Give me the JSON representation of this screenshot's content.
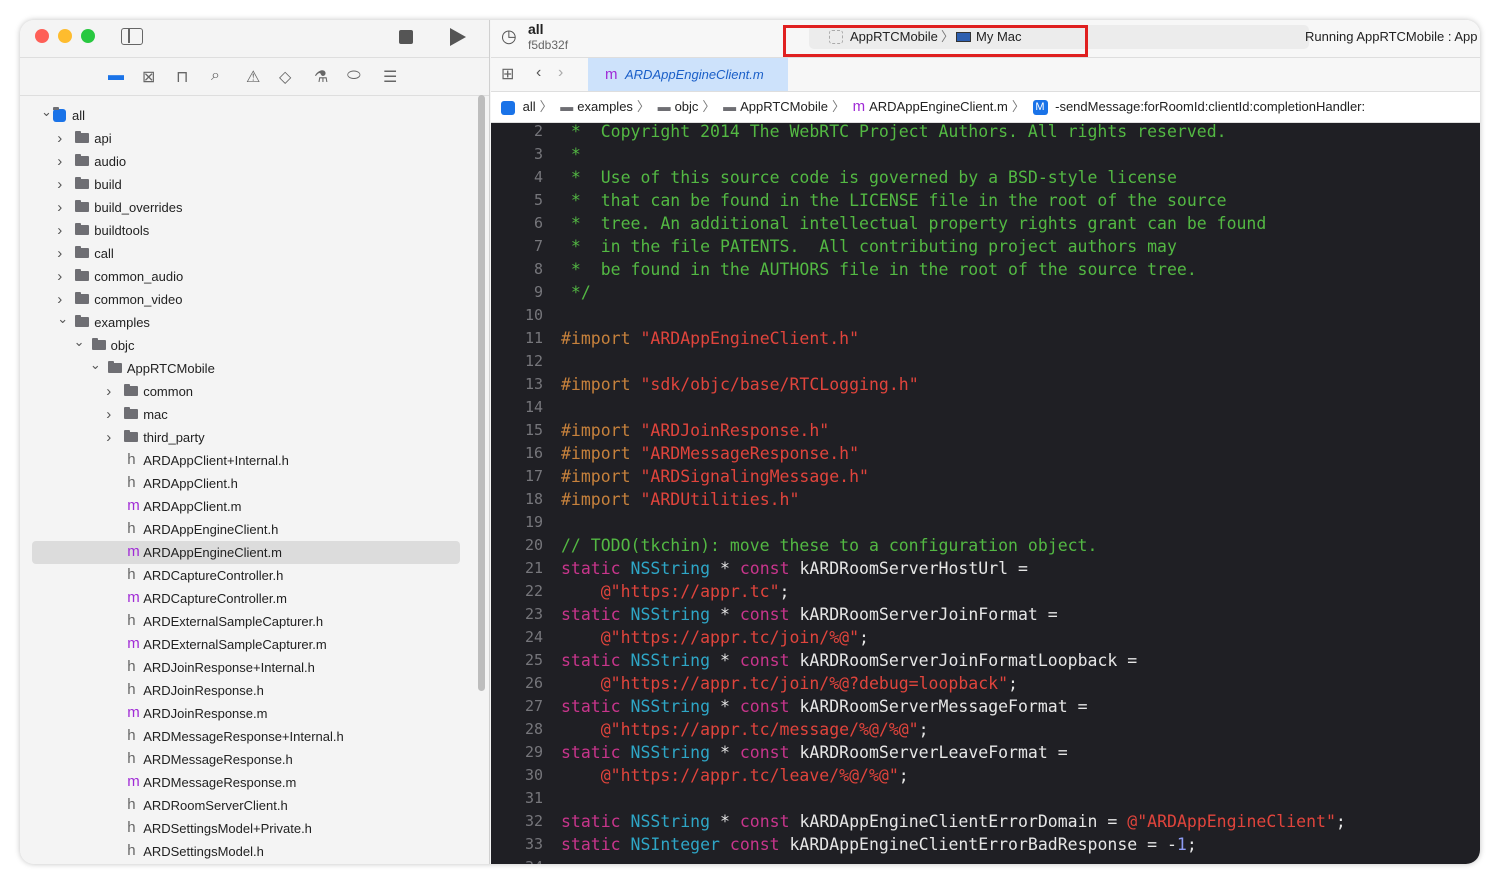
{
  "toolbar": {
    "scheme_title": "all",
    "commit": "f5db32f",
    "scheme": "AppRTCMobile",
    "destination": "My Mac",
    "status": "Running AppRTCMobile : App"
  },
  "editor_tab": {
    "label": "ARDAppEngineClient.m"
  },
  "breadcrumb": [
    "all",
    "examples",
    "objc",
    "AppRTCMobile",
    "ARDAppEngineClient.m",
    "-sendMessage:forRoomId:clientId:completionHandler:"
  ],
  "navigator_icons": [
    "folder-icon",
    "source-control-icon",
    "hierarchy-icon",
    "search-icon",
    "warning-icon",
    "test-icon",
    "debug-icon",
    "breakpoint-icon",
    "report-icon"
  ],
  "tree": [
    {
      "label": "all",
      "level": 0,
      "kind": "project",
      "open": true
    },
    {
      "label": "api",
      "level": 1,
      "kind": "folder"
    },
    {
      "label": "audio",
      "level": 1,
      "kind": "folder"
    },
    {
      "label": "build",
      "level": 1,
      "kind": "folder"
    },
    {
      "label": "build_overrides",
      "level": 1,
      "kind": "folder"
    },
    {
      "label": "buildtools",
      "level": 1,
      "kind": "folder"
    },
    {
      "label": "call",
      "level": 1,
      "kind": "folder"
    },
    {
      "label": "common_audio",
      "level": 1,
      "kind": "folder"
    },
    {
      "label": "common_video",
      "level": 1,
      "kind": "folder"
    },
    {
      "label": "examples",
      "level": 1,
      "kind": "folder",
      "open": true
    },
    {
      "label": "objc",
      "level": 2,
      "kind": "folder",
      "open": true
    },
    {
      "label": "AppRTCMobile",
      "level": 3,
      "kind": "folder",
      "open": true
    },
    {
      "label": "common",
      "level": 4,
      "kind": "folder"
    },
    {
      "label": "mac",
      "level": 4,
      "kind": "folder"
    },
    {
      "label": "third_party",
      "level": 4,
      "kind": "folder"
    },
    {
      "label": "ARDAppClient+Internal.h",
      "level": 4,
      "kind": "h"
    },
    {
      "label": "ARDAppClient.h",
      "level": 4,
      "kind": "h"
    },
    {
      "label": "ARDAppClient.m",
      "level": 4,
      "kind": "m"
    },
    {
      "label": "ARDAppEngineClient.h",
      "level": 4,
      "kind": "h"
    },
    {
      "label": "ARDAppEngineClient.m",
      "level": 4,
      "kind": "m",
      "selected": true
    },
    {
      "label": "ARDCaptureController.h",
      "level": 4,
      "kind": "h"
    },
    {
      "label": "ARDCaptureController.m",
      "level": 4,
      "kind": "m"
    },
    {
      "label": "ARDExternalSampleCapturer.h",
      "level": 4,
      "kind": "h"
    },
    {
      "label": "ARDExternalSampleCapturer.m",
      "level": 4,
      "kind": "m"
    },
    {
      "label": "ARDJoinResponse+Internal.h",
      "level": 4,
      "kind": "h"
    },
    {
      "label": "ARDJoinResponse.h",
      "level": 4,
      "kind": "h"
    },
    {
      "label": "ARDJoinResponse.m",
      "level": 4,
      "kind": "m"
    },
    {
      "label": "ARDMessageResponse+Internal.h",
      "level": 4,
      "kind": "h"
    },
    {
      "label": "ARDMessageResponse.h",
      "level": 4,
      "kind": "h"
    },
    {
      "label": "ARDMessageResponse.m",
      "level": 4,
      "kind": "m"
    },
    {
      "label": "ARDRoomServerClient.h",
      "level": 4,
      "kind": "h"
    },
    {
      "label": "ARDSettingsModel+Private.h",
      "level": 4,
      "kind": "h"
    },
    {
      "label": "ARDSettingsModel.h",
      "level": 4,
      "kind": "h"
    }
  ],
  "code_first_line": 2,
  "code": [
    [
      [
        " *  Copyright 2014 The WebRTC Project Authors. All rights reserved.",
        "c"
      ]
    ],
    [
      [
        " *",
        "c"
      ]
    ],
    [
      [
        " *  Use of this source code is governed by a BSD-style license",
        "c"
      ]
    ],
    [
      [
        " *  that can be found in the LICENSE file in the root of the source",
        "c"
      ]
    ],
    [
      [
        " *  tree. An additional intellectual property rights grant can be found",
        "c"
      ]
    ],
    [
      [
        " *  in the file PATENTS.  All contributing project authors may",
        "c"
      ]
    ],
    [
      [
        " *  be found in the AUTHORS file in the root of the source tree.",
        "c"
      ]
    ],
    [
      [
        " */",
        "c"
      ]
    ],
    [],
    [
      [
        "#import ",
        "p"
      ],
      [
        "\"ARDAppEngineClient.h\"",
        "s"
      ]
    ],
    [],
    [
      [
        "#import ",
        "p"
      ],
      [
        "\"sdk/objc/base/RTCLogging.h\"",
        "s"
      ]
    ],
    [],
    [
      [
        "#import ",
        "p"
      ],
      [
        "\"ARDJoinResponse.h\"",
        "s"
      ]
    ],
    [
      [
        "#import ",
        "p"
      ],
      [
        "\"ARDMessageResponse.h\"",
        "s"
      ]
    ],
    [
      [
        "#import ",
        "p"
      ],
      [
        "\"ARDSignalingMessage.h\"",
        "s"
      ]
    ],
    [
      [
        "#import ",
        "p"
      ],
      [
        "\"ARDUtilities.h\"",
        "s"
      ]
    ],
    [],
    [
      [
        "// TODO(tkchin): move these to a configuration object.",
        "c"
      ]
    ],
    [
      [
        "static ",
        "k"
      ],
      [
        "NSString",
        "t"
      ],
      [
        " * ",
        "x"
      ],
      [
        "const",
        "k"
      ],
      [
        " kARDRoomServerHostUrl =",
        "x"
      ]
    ],
    [
      [
        "    @\"https://appr.tc\"",
        "s"
      ],
      [
        ";",
        "x"
      ]
    ],
    [
      [
        "static ",
        "k"
      ],
      [
        "NSString",
        "t"
      ],
      [
        " * ",
        "x"
      ],
      [
        "const",
        "k"
      ],
      [
        " kARDRoomServerJoinFormat =",
        "x"
      ]
    ],
    [
      [
        "    @\"https://appr.tc/join/%@\"",
        "s"
      ],
      [
        ";",
        "x"
      ]
    ],
    [
      [
        "static ",
        "k"
      ],
      [
        "NSString",
        "t"
      ],
      [
        " * ",
        "x"
      ],
      [
        "const",
        "k"
      ],
      [
        " kARDRoomServerJoinFormatLoopback =",
        "x"
      ]
    ],
    [
      [
        "    @\"https://appr.tc/join/%@?debug=loopback\"",
        "s"
      ],
      [
        ";",
        "x"
      ]
    ],
    [
      [
        "static ",
        "k"
      ],
      [
        "NSString",
        "t"
      ],
      [
        " * ",
        "x"
      ],
      [
        "const",
        "k"
      ],
      [
        " kARDRoomServerMessageFormat =",
        "x"
      ]
    ],
    [
      [
        "    @\"https://appr.tc/message/%@/%@\"",
        "s"
      ],
      [
        ";",
        "x"
      ]
    ],
    [
      [
        "static ",
        "k"
      ],
      [
        "NSString",
        "t"
      ],
      [
        " * ",
        "x"
      ],
      [
        "const",
        "k"
      ],
      [
        " kARDRoomServerLeaveFormat =",
        "x"
      ]
    ],
    [
      [
        "    @\"https://appr.tc/leave/%@/%@\"",
        "s"
      ],
      [
        ";",
        "x"
      ]
    ],
    [],
    [
      [
        "static ",
        "k"
      ],
      [
        "NSString",
        "t"
      ],
      [
        " * ",
        "x"
      ],
      [
        "const",
        "k"
      ],
      [
        " kARDAppEngineClientErrorDomain = ",
        "x"
      ],
      [
        "@\"ARDAppEngineClient\"",
        "s"
      ],
      [
        ";",
        "x"
      ]
    ],
    [
      [
        "static ",
        "k"
      ],
      [
        "NSInteger",
        "t"
      ],
      [
        " ",
        "x"
      ],
      [
        "const",
        "k"
      ],
      [
        " kARDAppEngineClientErrorBadResponse = -",
        "x"
      ],
      [
        "1",
        "n"
      ],
      [
        ";",
        "x"
      ]
    ],
    []
  ],
  "colors": {
    "accent": "#1a73e8",
    "highlight_box": "#e02020",
    "comment": "#53b843",
    "keyword": "#c8358c",
    "type": "#2ea6c6",
    "string": "#e0443c",
    "preprocessor": "#c6813c",
    "editor_bg": "#1f1f24"
  }
}
